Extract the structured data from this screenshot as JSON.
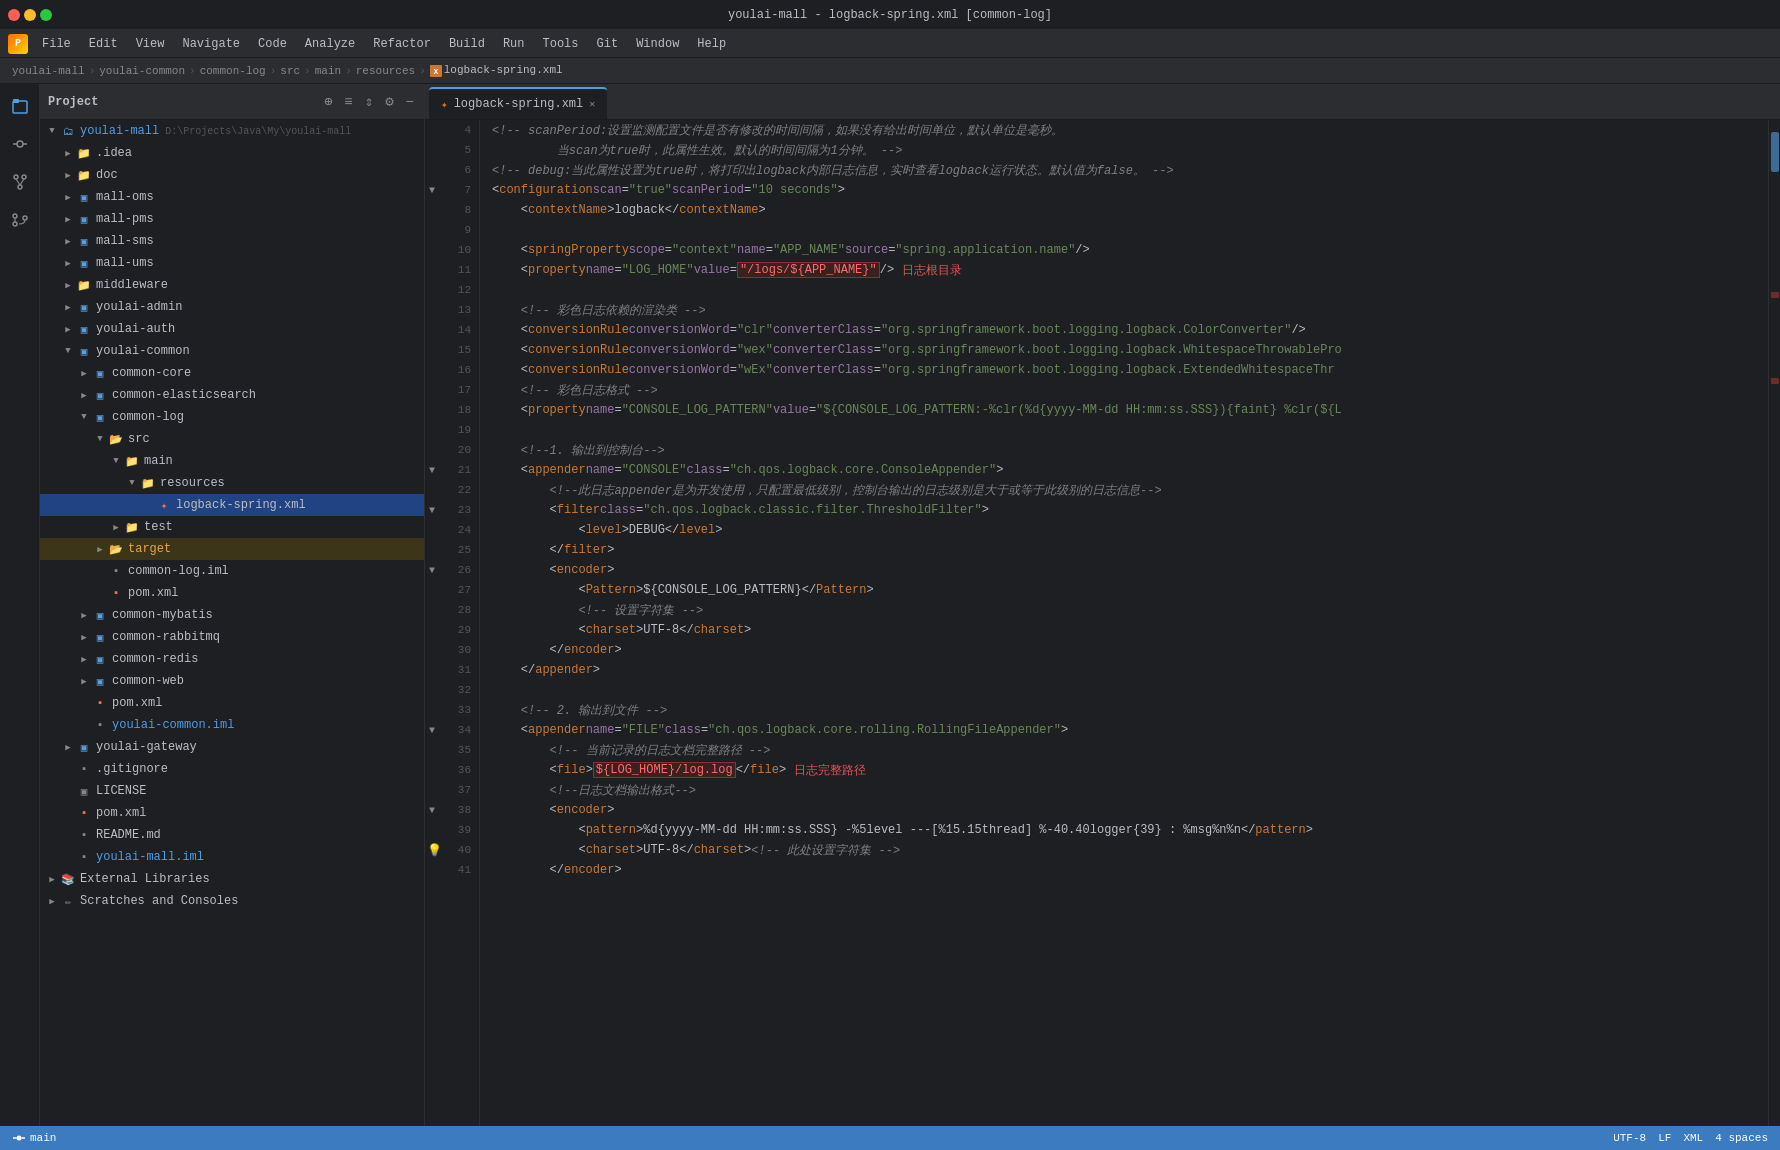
{
  "window": {
    "title": "youlai-mall - logback-spring.xml [common-log]",
    "traffic_lights": [
      "close",
      "minimize",
      "maximize"
    ]
  },
  "menu": {
    "items": [
      "File",
      "Edit",
      "View",
      "Navigate",
      "Code",
      "Analyze",
      "Refactor",
      "Build",
      "Run",
      "Tools",
      "Git",
      "Window",
      "Help"
    ]
  },
  "breadcrumb": {
    "items": [
      "youlai-mall",
      "youlai-common",
      "common-log",
      "src",
      "main",
      "resources",
      "logback-spring.xml"
    ]
  },
  "project_panel": {
    "title": "Project",
    "toolbar_icons": [
      "⊕",
      "≡",
      "⇕",
      "⚙",
      "−"
    ]
  },
  "tree": {
    "items": [
      {
        "level": 0,
        "type": "project-root",
        "label": "youlai-mall",
        "path": "D:\\Projects\\Java\\My\\youlai-mall",
        "expanded": true,
        "icon": "📁"
      },
      {
        "level": 1,
        "type": "folder",
        "label": ".idea",
        "expanded": false,
        "icon": "📁"
      },
      {
        "level": 1,
        "type": "folder",
        "label": "doc",
        "expanded": false,
        "icon": "📁"
      },
      {
        "level": 1,
        "type": "folder",
        "label": "mall-oms",
        "expanded": false,
        "icon": "module"
      },
      {
        "level": 1,
        "type": "folder",
        "label": "mall-pms",
        "expanded": false,
        "icon": "module"
      },
      {
        "level": 1,
        "type": "folder",
        "label": "mall-sms",
        "expanded": false,
        "icon": "module"
      },
      {
        "level": 1,
        "type": "folder",
        "label": "mall-ums",
        "expanded": false,
        "icon": "module"
      },
      {
        "level": 1,
        "type": "folder",
        "label": "middleware",
        "expanded": false,
        "icon": "folder"
      },
      {
        "level": 1,
        "type": "folder",
        "label": "youlai-admin",
        "expanded": false,
        "icon": "module"
      },
      {
        "level": 1,
        "type": "folder",
        "label": "youlai-auth",
        "expanded": false,
        "icon": "module"
      },
      {
        "level": 1,
        "type": "folder",
        "label": "youlai-common",
        "expanded": true,
        "icon": "module"
      },
      {
        "level": 2,
        "type": "folder",
        "label": "common-core",
        "expanded": false,
        "icon": "module"
      },
      {
        "level": 2,
        "type": "folder",
        "label": "common-elasticsearch",
        "expanded": false,
        "icon": "module"
      },
      {
        "level": 2,
        "type": "folder",
        "label": "common-log",
        "expanded": true,
        "icon": "module",
        "selected": false
      },
      {
        "level": 3,
        "type": "folder",
        "label": "src",
        "expanded": true,
        "icon": "src"
      },
      {
        "level": 4,
        "type": "folder",
        "label": "main",
        "expanded": true,
        "icon": "folder"
      },
      {
        "level": 5,
        "type": "folder",
        "label": "resources",
        "expanded": true,
        "icon": "folder"
      },
      {
        "level": 6,
        "type": "file",
        "label": "logback-spring.xml",
        "icon": "xml",
        "selected": true
      },
      {
        "level": 4,
        "type": "folder",
        "label": "test",
        "expanded": false,
        "icon": "folder"
      },
      {
        "level": 3,
        "type": "folder",
        "label": "target",
        "expanded": false,
        "icon": "target"
      },
      {
        "level": 3,
        "type": "file",
        "label": "common-log.iml",
        "icon": "iml"
      },
      {
        "level": 3,
        "type": "file",
        "label": "pom.xml",
        "icon": "pom"
      },
      {
        "level": 2,
        "type": "folder",
        "label": "common-mybatis",
        "expanded": false,
        "icon": "module"
      },
      {
        "level": 2,
        "type": "folder",
        "label": "common-rabbitmq",
        "expanded": false,
        "icon": "module"
      },
      {
        "level": 2,
        "type": "folder",
        "label": "common-redis",
        "expanded": false,
        "icon": "module"
      },
      {
        "level": 2,
        "type": "folder",
        "label": "common-web",
        "expanded": false,
        "icon": "module"
      },
      {
        "level": 2,
        "type": "file",
        "label": "pom.xml",
        "icon": "pom"
      },
      {
        "level": 2,
        "type": "file",
        "label": "youlai-common.iml",
        "icon": "iml"
      },
      {
        "level": 1,
        "type": "folder",
        "label": "youlai-gateway",
        "expanded": false,
        "icon": "module"
      },
      {
        "level": 1,
        "type": "file",
        "label": ".gitignore",
        "icon": "git"
      },
      {
        "level": 1,
        "type": "file",
        "label": "LICENSE",
        "icon": "license"
      },
      {
        "level": 1,
        "type": "file",
        "label": "pom.xml",
        "icon": "pom"
      },
      {
        "level": 1,
        "type": "file",
        "label": "README.md",
        "icon": "readme"
      },
      {
        "level": 1,
        "type": "file",
        "label": "youlai-mall.iml",
        "icon": "iml"
      },
      {
        "level": 0,
        "type": "folder",
        "label": "External Libraries",
        "expanded": false,
        "icon": "libs"
      },
      {
        "level": 0,
        "type": "folder",
        "label": "Scratches and Consoles",
        "expanded": false,
        "icon": "scratches"
      }
    ]
  },
  "editor": {
    "tab_label": "logback-spring.xml",
    "tab_icon": "xml"
  },
  "code_lines": [
    {
      "num": 4,
      "content": "<!-- scanPeriod:设置监测配置文件是否有修改的时间间隔，如果没有给出时间单位，默认单位是毫秒。",
      "type": "comment"
    },
    {
      "num": 5,
      "content": "         当scan为true时，此属性生效。默认的时间间隔为1分钟。 -->",
      "type": "comment"
    },
    {
      "num": 6,
      "content": "<!-- debug:当此属性设置为true时，将打印出logback内部日志信息，实时查看logback运行状态。默认值为false。 -->",
      "type": "comment"
    },
    {
      "num": 7,
      "content": "<configuration scan=\"true\" scanPeriod=\"10 seconds\">",
      "type": "xml"
    },
    {
      "num": 8,
      "content": "    <contextName>logback</contextName>",
      "type": "xml"
    },
    {
      "num": 9,
      "content": "",
      "type": "empty"
    },
    {
      "num": 10,
      "content": "    <springProperty scope=\"context\" name=\"APP_NAME\" source=\"spring.application.name\"/>",
      "type": "xml"
    },
    {
      "num": 11,
      "content": "    <property name=\"LOG_HOME\" value=\"/logs/${APP_NAME}\" />  日志根目录",
      "type": "xml_annotated"
    },
    {
      "num": 12,
      "content": "",
      "type": "empty"
    },
    {
      "num": 13,
      "content": "    <!-- 彩色日志依赖的渲染类 -->",
      "type": "comment_indented"
    },
    {
      "num": 14,
      "content": "    <conversionRule conversionWord=\"clr\" converterClass=\"org.springframework.boot.logging.logback.ColorConverter\" />",
      "type": "xml"
    },
    {
      "num": 15,
      "content": "    <conversionRule conversionWord=\"wex\" converterClass=\"org.springframework.boot.logging.logback.WhitespaceThrowablePro",
      "type": "xml"
    },
    {
      "num": 16,
      "content": "    <conversionRule conversionWord=\"wEx\" converterClass=\"org.springframework.boot.logging.logback.ExtendedWhitespaceThr",
      "type": "xml"
    },
    {
      "num": 17,
      "content": "    <!-- 彩色日志格式 -->",
      "type": "comment_indented"
    },
    {
      "num": 18,
      "content": "    <property name=\"CONSOLE_LOG_PATTERN\" value=\"${CONSOLE_LOG_PATTERN:-%clr(%d{yyyy-MM-dd HH:mm:ss.SSS}){faint} %clr(${L",
      "type": "xml"
    },
    {
      "num": 19,
      "content": "",
      "type": "empty"
    },
    {
      "num": 20,
      "content": "    <!--1. 输出到控制台-->",
      "type": "comment_indented"
    },
    {
      "num": 21,
      "content": "    <appender name=\"CONSOLE\" class=\"ch.qos.logback.core.ConsoleAppender\">",
      "type": "xml"
    },
    {
      "num": 22,
      "content": "        <!--此日志appender是为开发使用，只配置最低级别，控制台输出的日志级别是大于或等于此级别的日志信息-->",
      "type": "comment"
    },
    {
      "num": 23,
      "content": "        <filter class=\"ch.qos.logback.classic.filter.ThresholdFilter\">",
      "type": "xml"
    },
    {
      "num": 24,
      "content": "            <level>DEBUG</level>",
      "type": "xml"
    },
    {
      "num": 25,
      "content": "        </filter>",
      "type": "xml"
    },
    {
      "num": 26,
      "content": "        <encoder>",
      "type": "xml"
    },
    {
      "num": 27,
      "content": "            <Pattern>${CONSOLE_LOG_PATTERN}</Pattern>",
      "type": "xml"
    },
    {
      "num": 28,
      "content": "            <!-- 设置字符集 -->",
      "type": "comment"
    },
    {
      "num": 29,
      "content": "            <charset>UTF-8</charset>",
      "type": "xml"
    },
    {
      "num": 30,
      "content": "        </encoder>",
      "type": "xml"
    },
    {
      "num": 31,
      "content": "    </appender>",
      "type": "xml"
    },
    {
      "num": 32,
      "content": "",
      "type": "empty"
    },
    {
      "num": 33,
      "content": "    <!-- 2. 输出到文件  -->",
      "type": "comment_indented"
    },
    {
      "num": 34,
      "content": "    <appender name=\"FILE\" class=\"ch.qos.logback.core.rolling.RollingFileAppender\">",
      "type": "xml"
    },
    {
      "num": 35,
      "content": "        <!-- 当前记录的日志文档完整路径 -->",
      "type": "comment"
    },
    {
      "num": 36,
      "content": "        <file>${LOG_HOME}/log.log</file>  日志完整路径",
      "type": "xml_annotated2"
    },
    {
      "num": 37,
      "content": "        <!--日志文档输出格式-->",
      "type": "comment"
    },
    {
      "num": 38,
      "content": "        <encoder>",
      "type": "xml"
    },
    {
      "num": 39,
      "content": "            <pattern>%d{yyyy-MM-dd HH:mm:ss.SSS} -%5level ---[%15.15thread] %-40.40logger{39} : %msg%n%n</pattern>",
      "type": "xml"
    },
    {
      "num": 40,
      "content": "            <charset>UTF-8</charset> <!-- 此处设置字符集 -->",
      "type": "xml"
    },
    {
      "num": 41,
      "content": "        </encoder>",
      "type": "xml"
    }
  ],
  "status_bar": {
    "items": [
      "Git: main",
      "UTF-8",
      "LF",
      "XML",
      "4 spaces"
    ]
  },
  "bottom": {
    "scratches_label": "Scratches and Consoles"
  }
}
